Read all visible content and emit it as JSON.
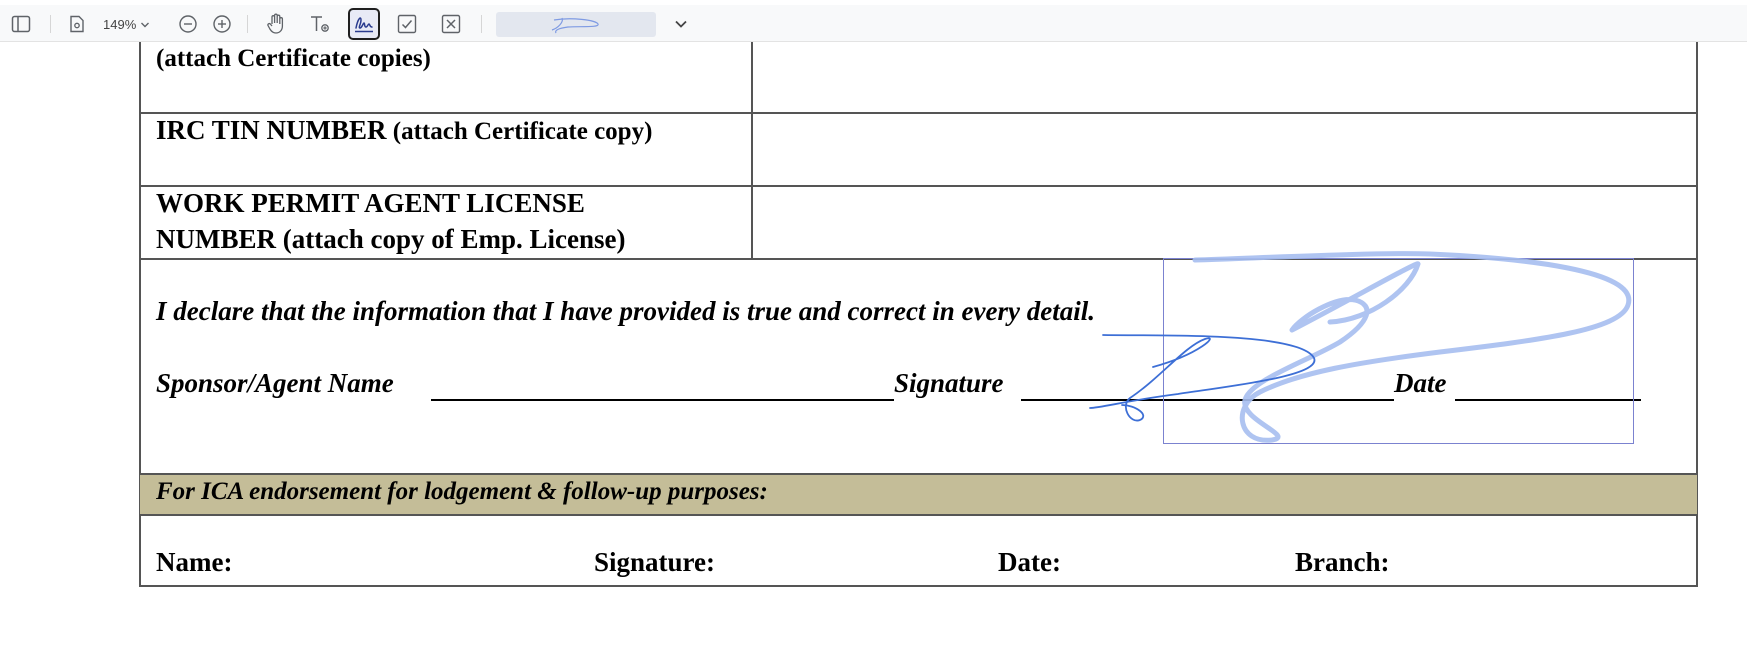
{
  "toolbar": {
    "zoom_label": "149%",
    "icons": [
      "sidebar-toggle-icon",
      "page-thumbnail-icon",
      "chevron-down-icon",
      "zoom-out-icon",
      "zoom-in-icon",
      "hand-tool-icon",
      "text-tool-icon",
      "signature-tool-icon",
      "checkmark-tool-icon",
      "cross-tool-icon",
      "chevron-down-icon"
    ],
    "active_tool": "signature",
    "accent": "#3b5bdb"
  },
  "form": {
    "row1_label": "(attach Certificate copies)",
    "row2_label_bold": "IRC TIN NUMBER",
    "row2_label_rest": " (attach Certificate copy)",
    "row3_line1": "WORK PERMIT AGENT LICENSE",
    "row3_line2": "NUMBER (attach copy of Emp. License)",
    "declaration": "I declare that the information that I have provided is true and correct in every detail.",
    "sponsor_label": "Sponsor/Agent Name",
    "signature_label": "Signature",
    "date_label": "Date",
    "endorsement_heading": "For ICA endorsement for lodgement & follow-up purposes:",
    "footer_name": "Name:",
    "footer_signature": "Signature:",
    "footer_date": "Date:",
    "footer_branch": "Branch:",
    "band_color": "#c4bd98",
    "signature_ink_color": "#3d6fd6"
  }
}
